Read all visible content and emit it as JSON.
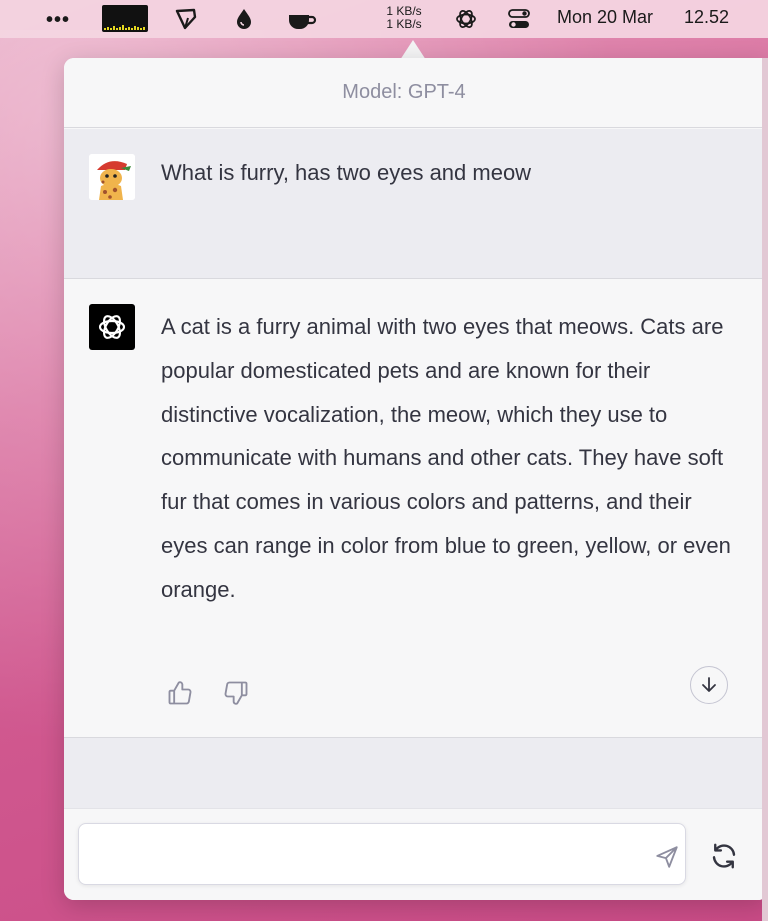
{
  "menubar": {
    "dots": "•••",
    "net_up": "1 KB/s",
    "net_down": "1 KB/s",
    "date": "Mon 20 Mar",
    "time": "12.52",
    "icons": [
      "overflow-icon",
      "activity-meter-icon",
      "pen-tool-icon",
      "droplet-icon",
      "coffee-cup-icon",
      "network-speed",
      "openai-icon",
      "control-center-icon"
    ]
  },
  "panel": {
    "model_label": "Model: GPT-4"
  },
  "conversation": {
    "user_message": "What is furry, has two eyes and meow",
    "assistant_message": "A cat is a furry animal with two eyes that meows. Cats are popular domesticated pets and are known for their distinctive vocalization, the meow, which they use to communicate with humans and other cats. They have soft fur that comes in various colors and patterns, and their eyes can range in color from blue to green, yellow, or even orange."
  },
  "composer": {
    "placeholder": "",
    "value": ""
  },
  "colors": {
    "accent_text": "#343541",
    "muted_text": "#8e8ea0",
    "user_bg": "#ececf1",
    "assistant_bg": "#f7f7f8"
  }
}
